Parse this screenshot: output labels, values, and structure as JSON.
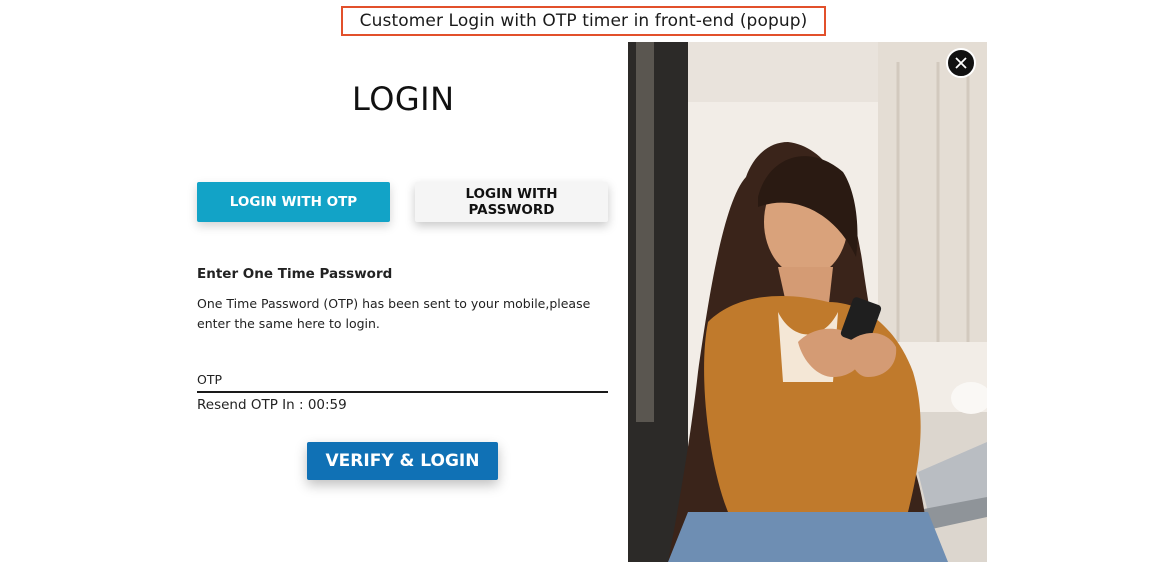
{
  "caption": "Customer Login with OTP timer in front-end (popup)",
  "popup": {
    "title": "LOGIN",
    "tabs": [
      {
        "label": "LOGIN WITH OTP",
        "active": true
      },
      {
        "label": "LOGIN WITH PASSWORD",
        "active": false
      }
    ],
    "otp_section": {
      "heading": "Enter One Time Password",
      "description": "One Time Password (OTP) has been sent to your mobile,please enter the same here to login.",
      "input_placeholder": "OTP",
      "input_value": "",
      "resend_label": "Resend OTP In : ",
      "resend_timer": "00:59"
    },
    "verify_button": "VERIFY & LOGIN",
    "close_icon": "close-icon",
    "image_icon": "photo-woman-using-phone"
  },
  "colors": {
    "caption_border": "#e2502b",
    "otp_tab": "#12a3c7",
    "password_tab": "#f5f5f5",
    "verify_button": "#1071b5",
    "close_button": "#111111"
  }
}
